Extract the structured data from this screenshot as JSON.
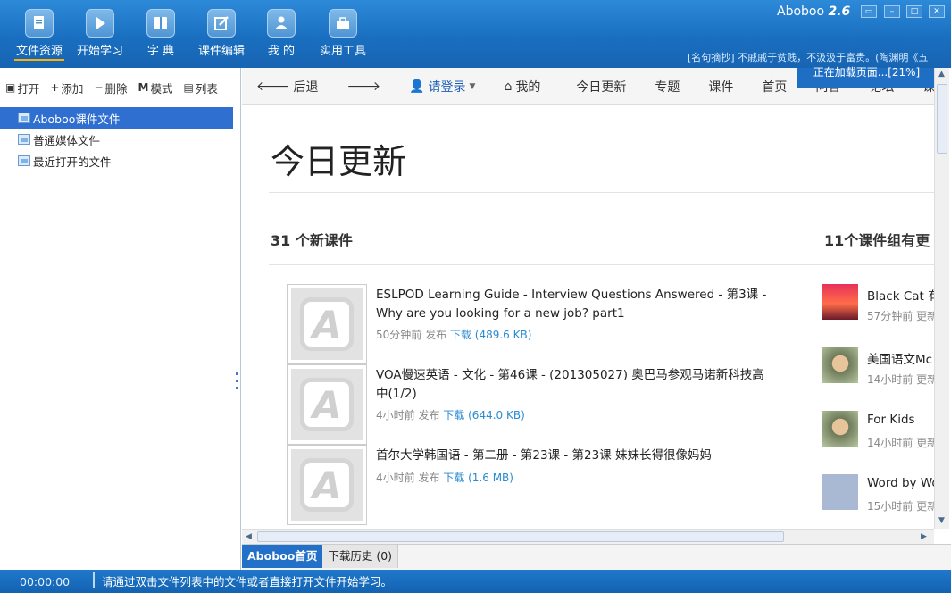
{
  "topbar": {
    "buttons": [
      {
        "label": "文件资源",
        "icon": "file-resource-icon"
      },
      {
        "label": "开始学习",
        "icon": "play-icon"
      },
      {
        "label": "字 典",
        "icon": "dictionary-icon"
      },
      {
        "label": "课件编辑",
        "icon": "edit-icon"
      },
      {
        "label": "我 的",
        "icon": "user-icon"
      },
      {
        "label": "实用工具",
        "icon": "toolbox-icon"
      }
    ],
    "app_name": "Aboboo",
    "version": "2.6",
    "quote": "[名句摘抄] 不戚戚于贫贱，不汲汲于富贵。(陶渊明《五"
  },
  "left": {
    "toolbar": [
      {
        "label": "打开",
        "icon": "open-icon"
      },
      {
        "label": "添加",
        "icon": "plus-icon"
      },
      {
        "label": "删除",
        "icon": "minus-icon"
      },
      {
        "label": "模式",
        "icon": "mode-icon"
      },
      {
        "label": "列表",
        "icon": "list-icon"
      }
    ],
    "tree": [
      "Aboboo课件文件",
      "普通媒体文件",
      "最近打开的文件"
    ]
  },
  "nav": {
    "back": "后退",
    "login": "请登录",
    "mine": "我的",
    "links": [
      "今日更新",
      "专题",
      "课件",
      "首页",
      "问答",
      "论坛",
      "课程"
    ],
    "loading": "正在加载页面...[21%]"
  },
  "content": {
    "title": "今日更新",
    "new_count": "31 个新课件",
    "group_count": "11个课件组有更",
    "courses": [
      {
        "title": "ESLPOD Learning Guide - Interview Questions Answered - 第3课 - Why are you looking for a new job? part1",
        "time": "50分钟前 发布",
        "download": "下载",
        "size": "(489.6 KB)"
      },
      {
        "title": "VOA慢速英语 - 文化 - 第46课 - (201305027) 奥巴马参观马诺新科技高中(1/2)",
        "time": "4小时前 发布",
        "download": "下载",
        "size": "(644.0 KB)"
      },
      {
        "title": "首尔大学韩国语 - 第二册 - 第23课 - 第23课 妹妹长得很像妈妈",
        "time": "4小时前 发布",
        "download": "下载",
        "size": "(1.6 MB)"
      }
    ],
    "groups": [
      {
        "name": "Black Cat 有",
        "meta": "57分钟前 更新"
      },
      {
        "name": "美国语文Mc",
        "meta": "14小时前 更新"
      },
      {
        "name": "For Kids",
        "meta": "14小时前 更新"
      },
      {
        "name": "Word by Wo",
        "meta": "15小时前 更新"
      }
    ]
  },
  "tabs": [
    "Aboboo首页",
    "下载历史 (0)"
  ],
  "status": {
    "time": "00:00:00",
    "message": "请通过双击文件列表中的文件或者直接打开文件开始学习。"
  },
  "colors": {
    "topbar": "#1a6fc0",
    "accent": "#2a8bd0",
    "tab_active": "#2370c8"
  }
}
